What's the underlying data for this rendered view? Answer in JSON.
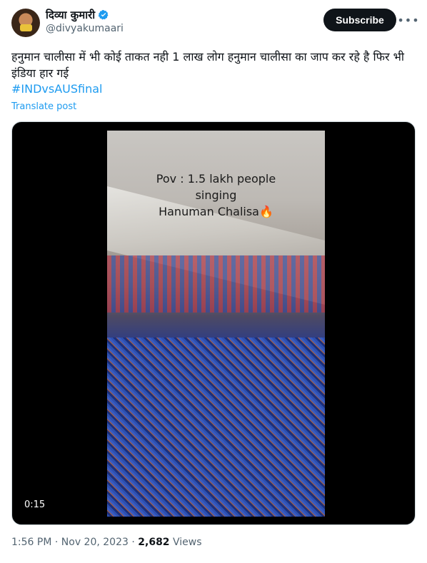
{
  "author": {
    "display_name": "दिव्या कुमारी",
    "handle": "@divyakumaari"
  },
  "subscribe_label": "Subscribe",
  "more_label": "•••",
  "post": {
    "text": "हनुमान चालीसा में भी कोई ताकत नही 1 लाख लोग हनुमान चालीसा का जाप कर रहे है फिर भी इंडिया हार गई",
    "hashtag": "#INDvsAUSfinal",
    "translate_label": "Translate post"
  },
  "video": {
    "overlay_lines": [
      "Pov : 1.5 lakh people",
      "singing",
      "Hanuman Chalisa🔥"
    ],
    "duration": "0:15"
  },
  "meta": {
    "time": "1:56 PM",
    "separator": "·",
    "date": "Nov 20, 2023",
    "views_count": "2,682",
    "views_label": "Views"
  },
  "colors": {
    "accent": "#1d9bf0",
    "text": "#0f1419",
    "muted": "#536471"
  }
}
